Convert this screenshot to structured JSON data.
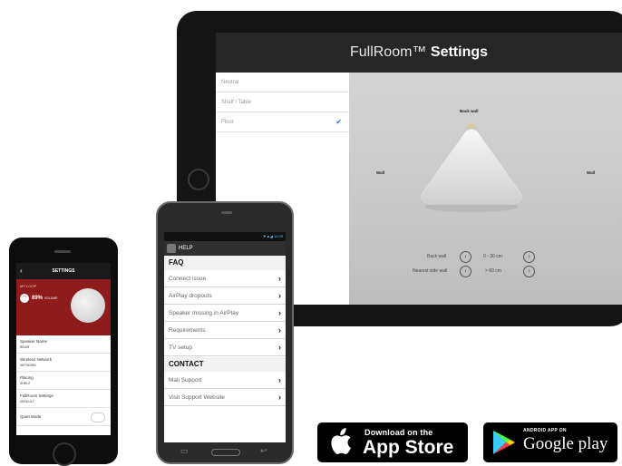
{
  "tablet": {
    "title_light": "FullRoom™",
    "title_bold": "Settings",
    "placement_options": [
      {
        "label": "Neutral",
        "selected": false
      },
      {
        "label": "Shelf / Table",
        "selected": false
      },
      {
        "label": "Floor",
        "selected": true
      }
    ],
    "stage": {
      "back_wall_label": "Back wall",
      "left_wall_label": "Wall",
      "right_wall_label": "Wall",
      "back_wall_distance_label": "Back wall",
      "back_wall_distance_value": "0 - 30 cm",
      "side_wall_distance_label": "Nearest side wall",
      "side_wall_distance_value": "> 60 cm"
    }
  },
  "android": {
    "status": "▼▲◢ 10:29",
    "app_title": "HELP",
    "sections": [
      {
        "header": "FAQ",
        "items": [
          "Connect issue",
          "AirPlay dropouts",
          "Speaker missing in AirPlay",
          "Requirements",
          "TV setup"
        ]
      },
      {
        "header": "CONTACT",
        "items": [
          "Mail Support",
          "Visit Support Website"
        ]
      }
    ]
  },
  "iphone": {
    "nav_title": "SETTINGS",
    "back_glyph": "‹",
    "hero_label": "MY LOOP",
    "volume_percent": "89%",
    "volume_caption": "VOLUME",
    "rows": [
      {
        "key": "Speaker Name",
        "value": "BEAM"
      },
      {
        "key": "Wireless Network",
        "value": "NETWORK"
      },
      {
        "key": "Placing",
        "value": "SHELF"
      },
      {
        "key": "FullRoom Settings",
        "value": "DEFAULT"
      },
      {
        "key": "Quiet Mode",
        "value": ""
      }
    ]
  },
  "badges": {
    "appstore_small": "Download on the",
    "appstore_big": "App Store",
    "gplay_small": "ANDROID APP ON",
    "gplay_big": "Google play"
  }
}
